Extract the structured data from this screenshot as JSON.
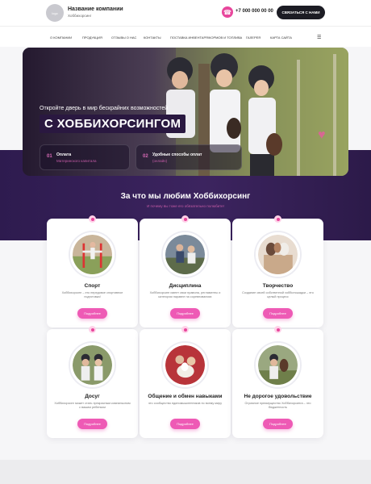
{
  "header": {
    "logo_text": "logo",
    "company_name": "Название компании",
    "company_sub": "Хоббихорсинг",
    "phone": "+7 000 000 00 00",
    "contact_button": "СВЯЗАТЬСЯ С НАМИ"
  },
  "nav": {
    "items": [
      "О компании",
      "Продукция",
      "Отзывы о нас",
      "Контакты",
      "Поставка инвентаря/кормов и топлива",
      "Галерея",
      "Карта сайта"
    ]
  },
  "hero": {
    "tagline": "Откройте дверь в мир бескрайних возможностей",
    "title": "С ХОББИХОРСИНГОМ",
    "features": [
      {
        "num": "01",
        "title": "Оплата",
        "subtitle": "Материнского капитала"
      },
      {
        "num": "02",
        "title": "Удобные способы оплат",
        "subtitle": "(онлайн)"
      }
    ]
  },
  "section": {
    "title": "За что мы любим Хоббихорсинг",
    "subtitle": "И почему вы тоже его обязательно полюбите!"
  },
  "cards": [
    {
      "title": "Спорт",
      "text": "Хоббихорсинг – это передовое спортивное подготовка!",
      "button": "Подробнее"
    },
    {
      "title": "Дисциплина",
      "text": "Хоббихорсинг имеет свои правила, регламенты и категории наравне на соревнованиях",
      "button": "Подробнее"
    },
    {
      "title": "Творчество",
      "text": "Создание своей собственной хоббилошадки – это целый процесс",
      "button": "Подробнее"
    },
    {
      "title": "Досуг",
      "text": "Хоббихорсинг может стать прекрасным компаньоном с вашим ребенком",
      "button": "Подробнее"
    },
    {
      "title": "Общение и обмен навыками",
      "text": "это сообщество единомышленников по всему миру",
      "button": "Подробнее"
    },
    {
      "title": "Не дорогое удовольствие",
      "text": "Огромное преимущество Хоббихорсинга – это бюджетность",
      "button": "Подробнее"
    }
  ],
  "colors": {
    "accent": "#ee5ab5",
    "dark": "#1c1c24",
    "purple": "#3c245f"
  }
}
